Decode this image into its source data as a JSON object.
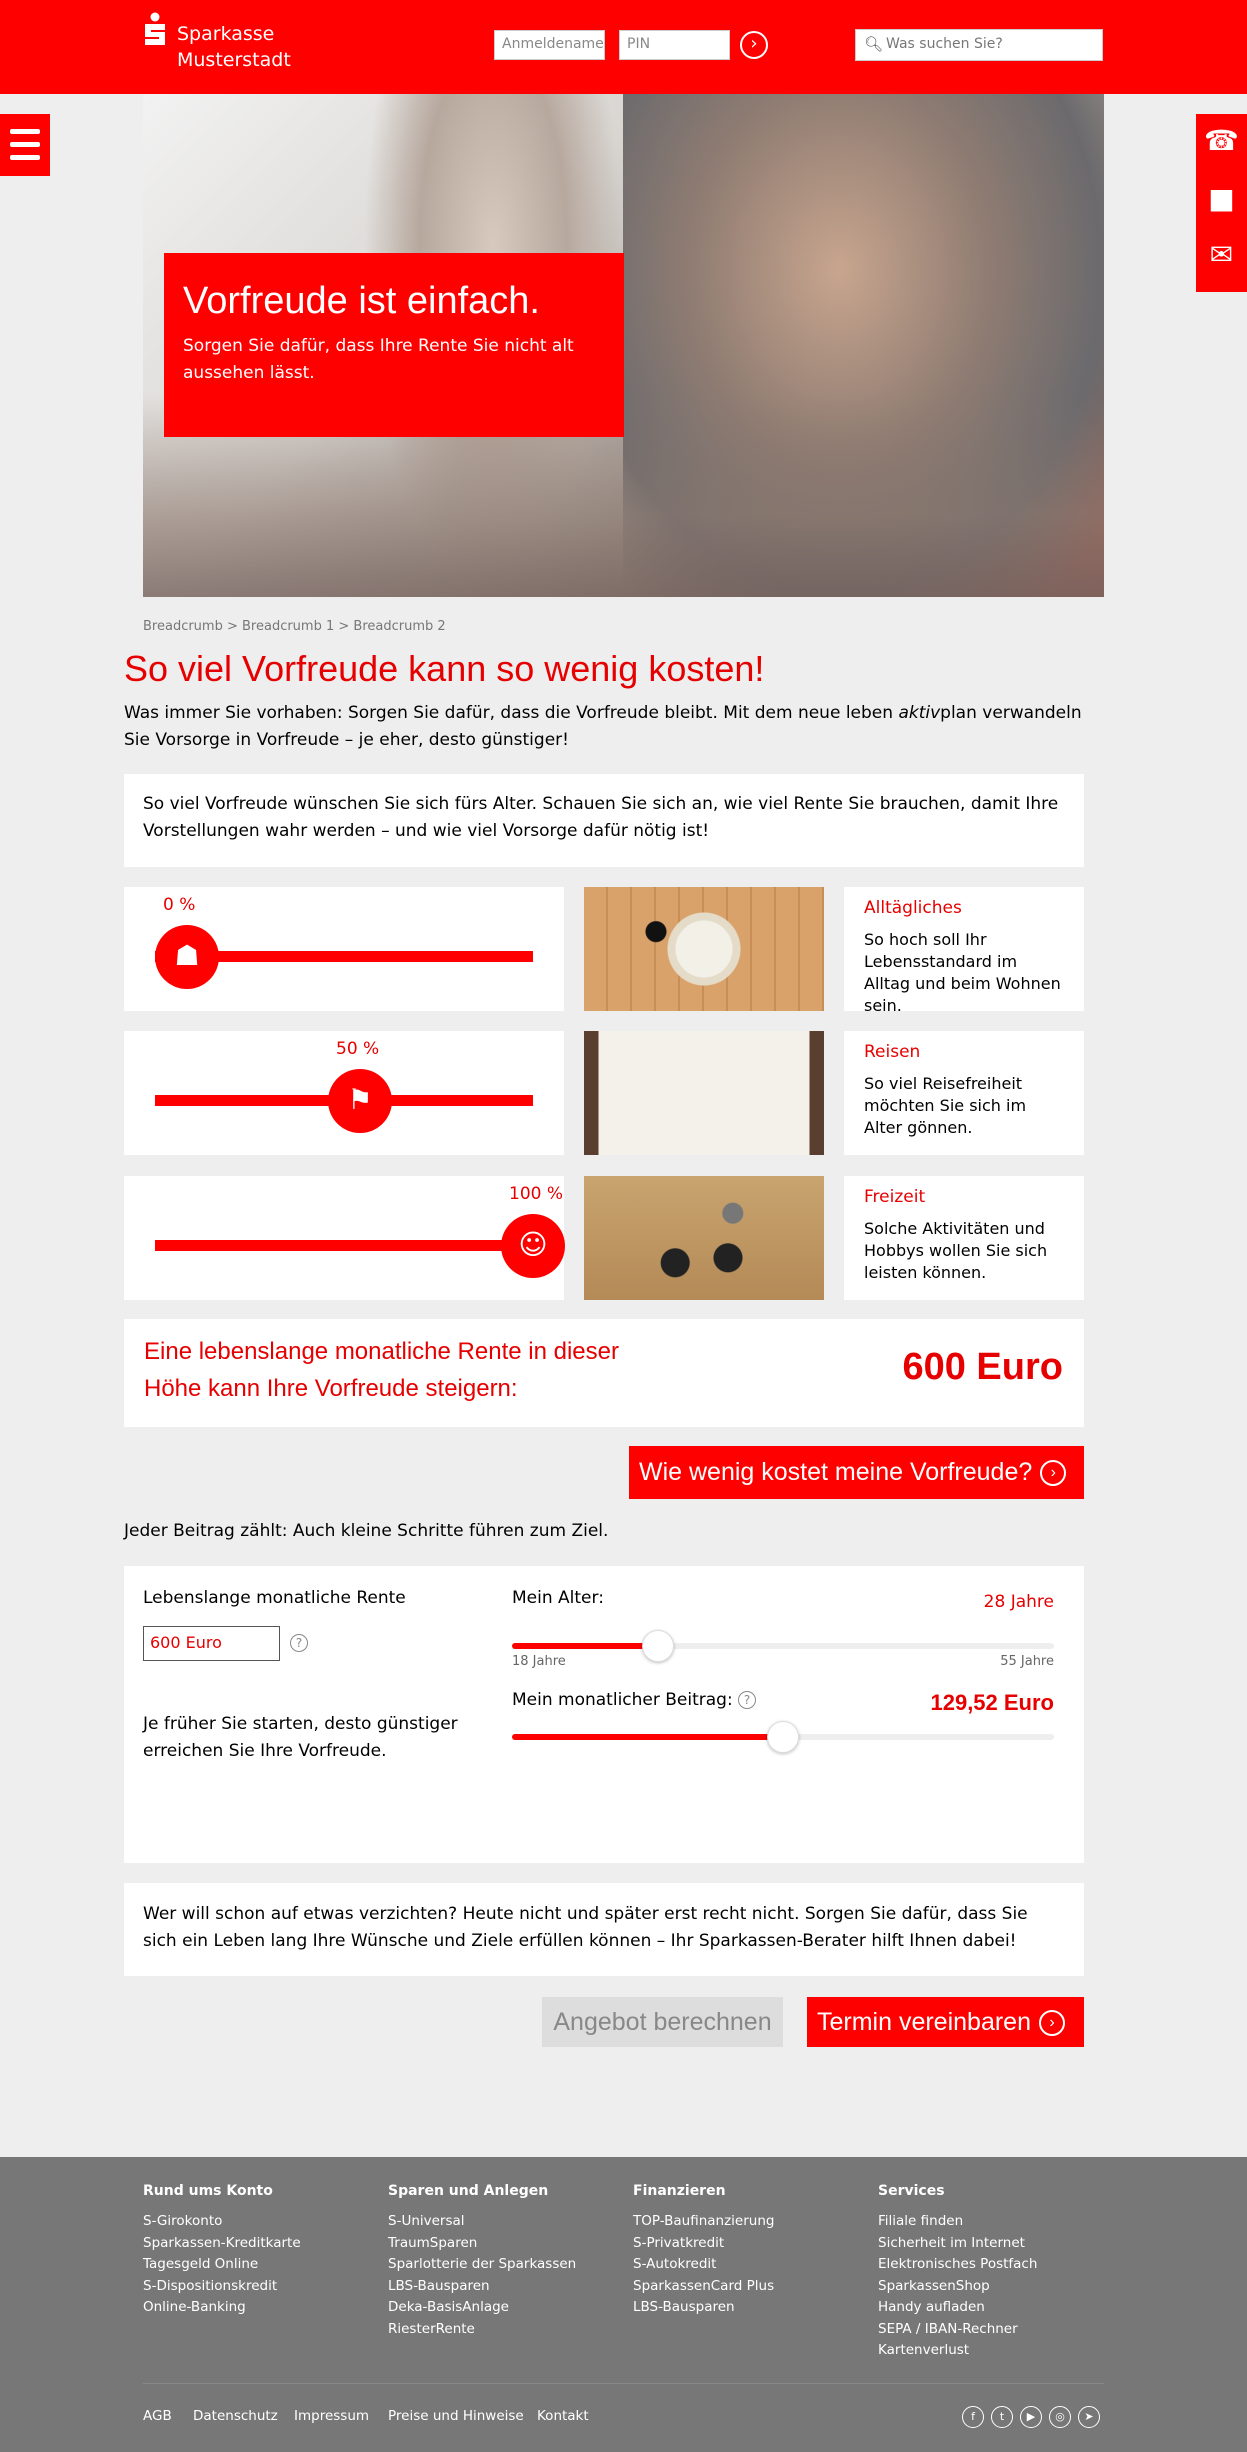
{
  "header": {
    "brand_line1": "Sparkasse",
    "brand_line2": "Musterstadt",
    "login_placeholder": "Anmeldename",
    "pin_placeholder": "PIN",
    "search_placeholder": "Was suchen Sie?"
  },
  "hero": {
    "title": "Vorfreude ist einfach.",
    "subtitle": "Sorgen Sie dafür, dass Ihre Rente Sie nicht alt aussehen lässt."
  },
  "breadcrumb": "Breadcrumb > Breadcrumb 1 > Breadcrumb 2",
  "main": {
    "title": "So viel Vorfreude kann so wenig kosten!",
    "intro_part1": "Was immer Sie vorhaben: Sorgen Sie dafür, dass die Vorfreude bleibt. Mit dem neue leben ",
    "intro_em": "aktiv",
    "intro_part2": "plan verwandeln Sie Vorsorge in Vorfreude – je eher, desto günstiger!",
    "box_text": "So viel Vorfreude wünschen Sie sich fürs Alter. Schauen Sie sich an, wie viel Rente Sie brauchen, damit Ihre Vorstellungen wahr werden – und wie viel Vorsorge dafür nötig ist!"
  },
  "categories": [
    {
      "percent_label": "0 %",
      "percent": 0,
      "title": "Alltägliches",
      "text": "So hoch soll Ihr Lebensstandard im Alltag und beim Wohnen sein.",
      "icon": "mortar-icon"
    },
    {
      "percent_label": "50 %",
      "percent": 50,
      "title": "Reisen",
      "text": "So viel Reisefreiheit möchten Sie sich im Alter gönnen.",
      "icon": "deckchair-icon"
    },
    {
      "percent_label": "100 %",
      "percent": 100,
      "title": "Freizeit",
      "text": "Solche Aktivitäten und Hobbys wollen Sie sich leisten können.",
      "icon": "smiley-icon"
    }
  ],
  "result": {
    "text_line1": "Eine lebenslange monatliche Rente in dieser",
    "text_line2": "Höhe kann Ihre Vorfreude steigern:",
    "amount": "600 Euro"
  },
  "cta1": "Wie wenig kostet meine Vorfreude?",
  "every_contribution": "Jeder Beitrag zählt: Auch kleine Schritte führen zum Ziel.",
  "calculator": {
    "rente_label": "Lebenslange monatliche Rente",
    "rente_value": "600 Euro",
    "hint": "Je früher Sie starten, desto günstiger erreichen Sie Ihre Vorfreude.",
    "age_label": "Mein Alter:",
    "age_value": "28 Jahre",
    "age_min": "18 Jahre",
    "age_max": "55 Jahre",
    "age_fraction": 0.27,
    "beitrag_label": "Mein monatlicher Beitrag:",
    "beitrag_value": "129,52 Euro",
    "beitrag_fraction": 0.5
  },
  "bottom_text": "Wer will schon auf etwas verzichten? Heute nicht und später erst recht nicht. Sorgen Sie dafür, dass Sie sich ein Leben lang Ihre Wünsche und Ziele erfüllen können – Ihr Sparkassen-Berater hilft Ihnen dabei!",
  "buttons": {
    "calculate": "Angebot berechnen",
    "appointment": "Termin vereinbaren"
  },
  "footer": {
    "columns": [
      {
        "title": "Rund ums Konto",
        "items": [
          "S-Girokonto",
          "Sparkassen-Kreditkarte",
          "Tagesgeld Online",
          "S-Dispositionskredit",
          "Online-Banking"
        ]
      },
      {
        "title": "Sparen und Anlegen",
        "items": [
          "S-Universal",
          "TraumSparen",
          "Sparlotterie der Sparkassen",
          "LBS-Bausparen",
          "Deka-BasisAnlage",
          "RiesterRente"
        ]
      },
      {
        "title": "Finanzieren",
        "items": [
          "TOP-Baufinanzierung",
          "S-Privatkredit",
          "S-Autokredit",
          "SparkassenCard Plus",
          "LBS-Bausparen"
        ]
      },
      {
        "title": "Services",
        "items": [
          "Filiale finden",
          "Sicherheit im Internet",
          "Elektronisches Postfach",
          "SparkassenShop",
          "Handy aufladen",
          "SEPA / IBAN-Rechner",
          "Kartenverlust"
        ]
      }
    ],
    "links": [
      "AGB",
      "Datenschutz",
      "Impressum",
      "Preise und Hinweise",
      "Kontakt"
    ],
    "social": [
      "facebook-icon",
      "twitter-icon",
      "youtube-icon",
      "instagram-icon",
      "telegram-icon"
    ]
  },
  "colors": {
    "brand_red": "#ff0000",
    "text_red": "#e60000",
    "footer_gray": "#777777",
    "bg_gray": "#eeeeee"
  }
}
